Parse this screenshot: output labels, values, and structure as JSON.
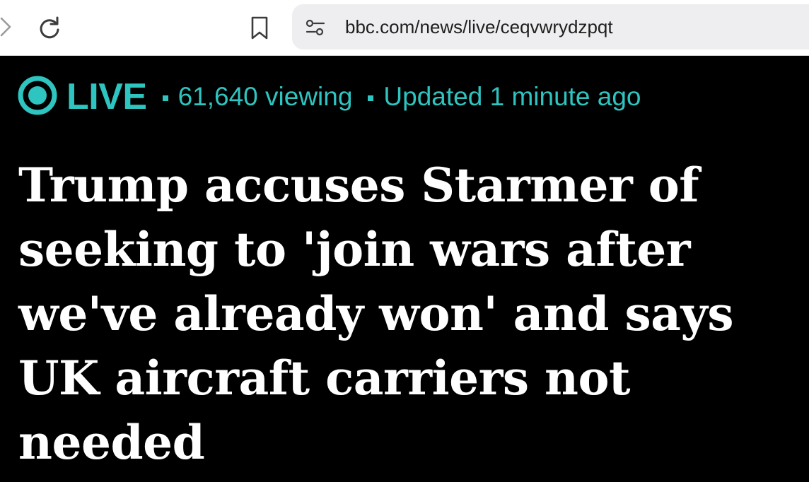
{
  "browser": {
    "url": "bbc.com/news/live/ceqvwrydzpqt",
    "icons": [
      "forward-icon",
      "reload-icon",
      "bookmark-icon",
      "site-settings-icon"
    ]
  },
  "live_banner": {
    "label": "LIVE",
    "viewers": "61,640 viewing",
    "updated": "Updated 1 minute ago",
    "accent_color": "#2ec4c0"
  },
  "headline": {
    "text": "Trump accuses Starmer of seeking to 'join wars after we've already won' and says UK aircraft carriers not needed"
  }
}
